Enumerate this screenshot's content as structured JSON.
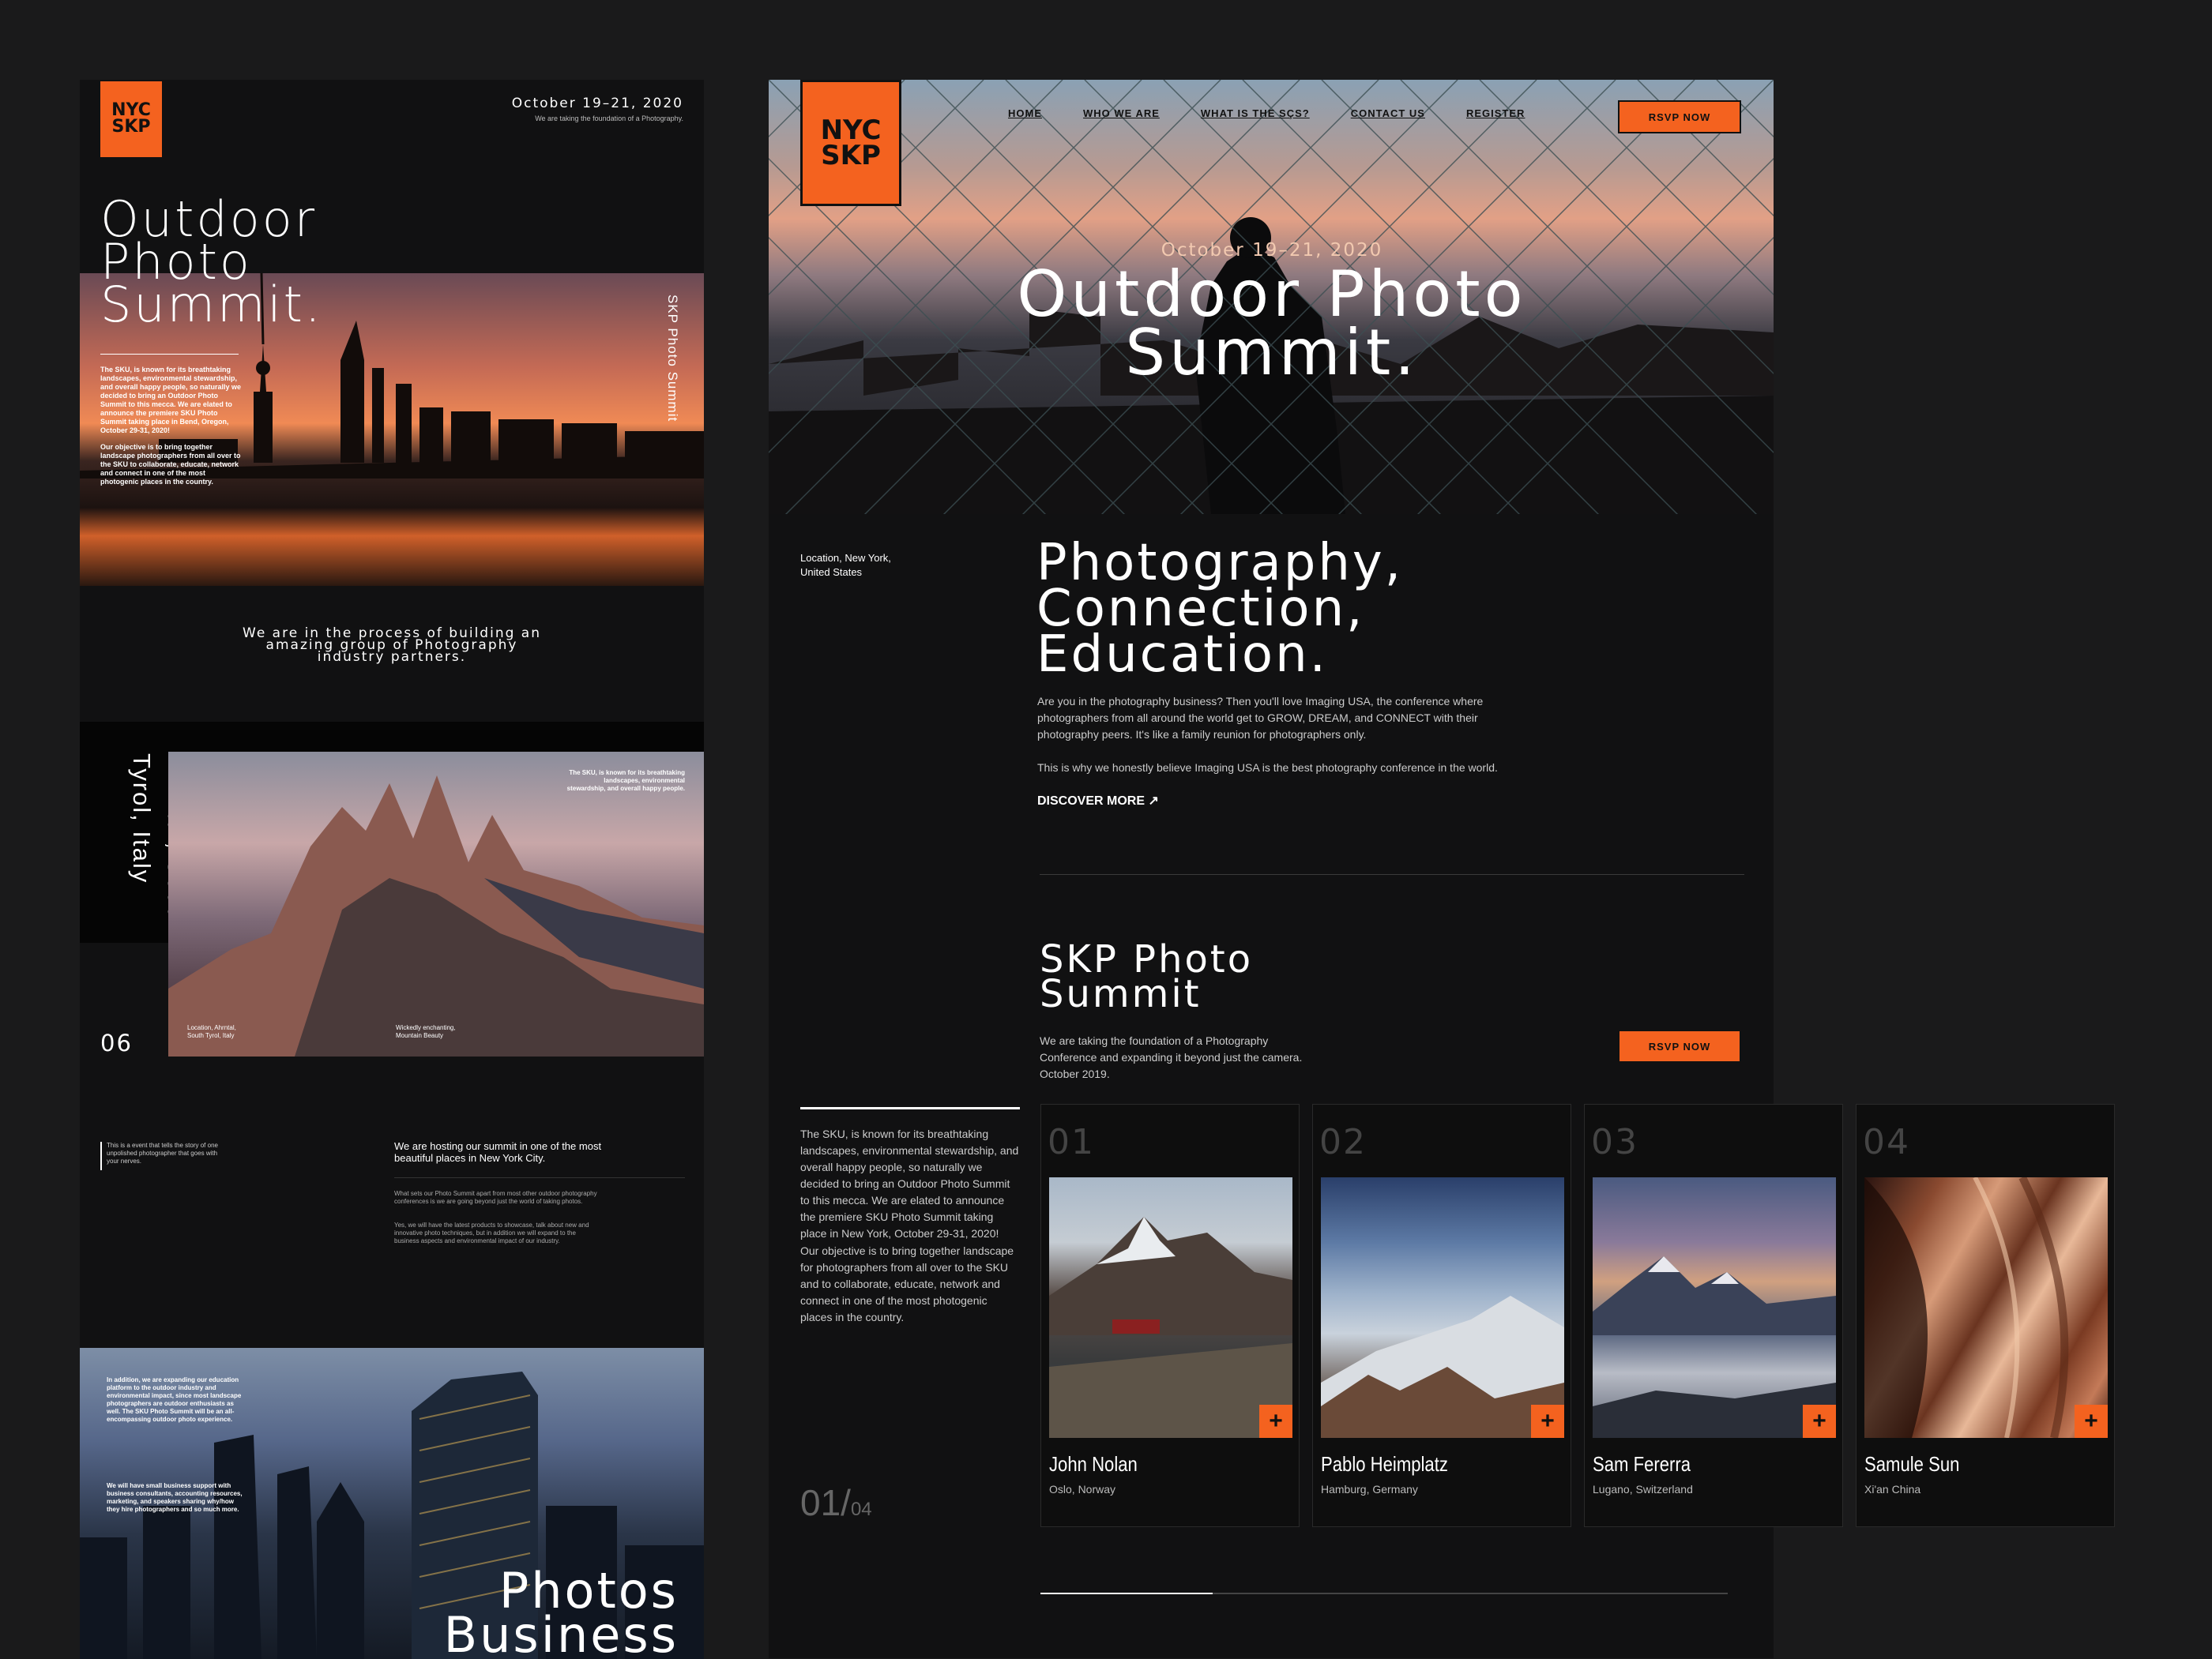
{
  "brand": {
    "logo_line1": "NYC",
    "logo_line2": "SKP"
  },
  "left": {
    "date": "October 19–21, 2020",
    "date_sub": "We are taking the foundation of a Photography.",
    "title_l1": "Outdoor",
    "title_l2": "Photo",
    "title_l3": "Summit.",
    "vertical_label": "SKP Photo Summit",
    "intro_p1": "The SKU, is known for its breathtaking landscapes, environmental stewardship, and overall happy people, so naturally we decided to bring an Outdoor Photo Summit to this mecca. We are elated to announce the premiere SKU Photo Summit taking place in Bend, Oregon, October 29-31, 2020!",
    "intro_p2": "Our objective is to bring together landscape photographers from all over to the SKU to collaborate, educate, network and connect in one of the most photogenic places in the country.",
    "partners_text": "We are in the process of building an amazing group of Photography industry partners.",
    "location_vertical": "Ahrntal, South Tyrol, Italy",
    "slide_number": "06",
    "mountain_caption": "The SKU, is known for its breathtaking landscapes, environmental stewardship, and overall happy people.",
    "caption_loc": "Location, Ahrntal, South Tyrol, Italy",
    "caption_beauty": "Wickedly enchanting, Mountain Beauty",
    "story_text": "This is a event that tells the story of one unpolished photographer that goes with your nerves.",
    "hosting_title": "We are hosting our summit in one of the most beautiful places in New York City.",
    "hosting_p1": "What sets our Photo Summit apart from most other outdoor photography conferences is we are going beyond just the world of taking photos.",
    "hosting_p2": "Yes, we will have the latest products to showcase, talk about new and innovative photo techniques, but in addition we will expand to the business aspects and environmental impact of our industry.",
    "city_p1": "In addition, we are expanding our education platform to the outdoor industry and environmental impact, since most landscape photographers are outdoor enthusiasts as well. The SKU Photo Summit will be an all-encompassing outdoor photo experience.",
    "city_p2": "We will have small business support with business consultants, accounting resources, marketing, and speakers sharing why/how they hire photographers and so much more.",
    "photos_l1": "Photos",
    "photos_l2": "Business"
  },
  "nav": {
    "items": [
      "HOME",
      "WHO WE ARE",
      "WHAT IS THE SÇS?",
      "CONTACT US",
      "REGISTER"
    ],
    "rsvp": "RSVP NOW"
  },
  "hero": {
    "date": "October 19–21, 2020",
    "title_l1": "Outdoor Photo",
    "title_l2": "Summit."
  },
  "about": {
    "location": "Location, New York, United States",
    "heading_l1": "Photography,",
    "heading_l2": "Connection,",
    "heading_l3": "Education.",
    "p1": "Are you in the photography business? Then you'll love Imaging USA, the conference where photographers from all around the world get to GROW, DREAM, and CONNECT with their photography peers. It's like a family reunion for photographers only.",
    "p2": "This is why we honestly believe Imaging USA is the best photography conference in the world.",
    "discover": "DISCOVER MORE ↗"
  },
  "summit": {
    "title_l1": "SKP Photo",
    "title_l2": "Summit",
    "desc": "We are taking the foundation of a Photography Conference and expanding it beyond just the camera. October 2019.",
    "rsvp": "RSVP NOW"
  },
  "speakers_intro": {
    "p1": "The SKU, is known for its breathtaking landscapes, environmental stewardship, and overall happy people, so naturally we decided to bring an Outdoor Photo Summit to this mecca. We are elated to announce the premiere SKU Photo Summit taking place in New York, October 29-31, 2020!",
    "p2": "Our objective is to bring together landscape for photographers from all over to the SKU and to collaborate, educate, network and connect in one of the most photogenic places in the country.",
    "page_current": "01/",
    "page_total": "04"
  },
  "speakers": [
    {
      "num": "01",
      "name": "John Nolan",
      "place": "Oslo, Norway"
    },
    {
      "num": "02",
      "name": "Pablo Heimplatz",
      "place": "Hamburg, Germany"
    },
    {
      "num": "03",
      "name": "Sam Fererra",
      "place": "Lugano, Switzerland"
    },
    {
      "num": "04",
      "name": "Samule Sun",
      "place": "Xi'an China"
    }
  ],
  "colors": {
    "accent": "#f4621f",
    "background": "#1a1a1b",
    "panel": "#111112"
  }
}
